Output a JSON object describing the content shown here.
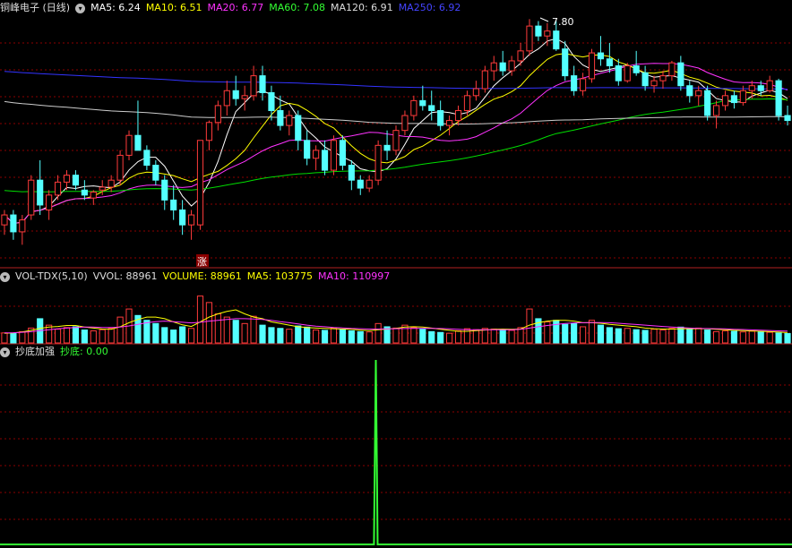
{
  "main_header": {
    "title": "铜峰电子 (日线)",
    "ma5": "MA5: 6.24",
    "ma10": "MA10: 6.51",
    "ma20": "MA20: 6.77",
    "ma60": "MA60: 7.08",
    "ma120": "MA120: 6.91",
    "ma250": "MA250: 6.92"
  },
  "vol_header": {
    "title": "VOL-TDX(5,10)",
    "vvol": "VVOL: 88961",
    "volume": "VOLUME: 88961",
    "ma5": "MA5: 103775",
    "ma10": "MA10: 110997"
  },
  "ind_header": {
    "title": "抄底加强",
    "value": "抄底: 0.00"
  },
  "annotations": {
    "high_label": "7.80",
    "zhang_label": "涨"
  },
  "colors": {
    "up": "#ff3b3b",
    "down": "#54ffff",
    "ma5": "#ffffff",
    "ma10": "#ffff00",
    "ma20": "#ff33ff",
    "ma60": "#00dd00",
    "ma120": "#cccccc",
    "ma250": "#3333ff",
    "signal": "#33ff33",
    "grid": "#8b0000"
  },
  "chart_data": [
    {
      "type": "candlestick",
      "ylim": [
        5.6,
        8.05
      ],
      "candles": [
        [
          5.95,
          6.1,
          5.85,
          6.05
        ],
        [
          6.05,
          6.1,
          5.8,
          5.88
        ],
        [
          5.88,
          6.05,
          5.75,
          6.0
        ],
        [
          6.05,
          6.45,
          6.0,
          6.4
        ],
        [
          6.4,
          6.6,
          6.05,
          6.15
        ],
        [
          6.1,
          6.3,
          6.0,
          6.25
        ],
        [
          6.25,
          6.45,
          6.2,
          6.38
        ],
        [
          6.38,
          6.5,
          6.3,
          6.45
        ],
        [
          6.45,
          6.5,
          6.3,
          6.35
        ],
        [
          6.3,
          6.4,
          6.2,
          6.25
        ],
        [
          6.22,
          6.3,
          6.15,
          6.28
        ],
        [
          6.3,
          6.4,
          6.25,
          6.33
        ],
        [
          6.33,
          6.45,
          6.28,
          6.4
        ],
        [
          6.4,
          6.7,
          6.35,
          6.65
        ],
        [
          6.65,
          6.9,
          6.6,
          6.85
        ],
        [
          6.85,
          7.2,
          6.75,
          6.7
        ],
        [
          6.7,
          6.75,
          6.5,
          6.55
        ],
        [
          6.55,
          6.6,
          6.35,
          6.4
        ],
        [
          6.4,
          6.45,
          6.1,
          6.2
        ],
        [
          6.2,
          6.35,
          6.0,
          6.1
        ],
        [
          6.1,
          6.2,
          5.85,
          5.95
        ],
        [
          5.95,
          6.1,
          5.8,
          6.05
        ],
        [
          5.95,
          6.3,
          5.9,
          6.8
        ],
        [
          6.8,
          7.0,
          6.7,
          6.98
        ],
        [
          6.98,
          7.2,
          6.9,
          7.15
        ],
        [
          7.15,
          7.4,
          7.05,
          7.3
        ],
        [
          7.3,
          7.45,
          7.15,
          7.22
        ],
        [
          7.22,
          7.35,
          7.1,
          7.25
        ],
        [
          7.25,
          7.55,
          7.2,
          7.45
        ],
        [
          7.45,
          7.55,
          7.2,
          7.28
        ],
        [
          7.28,
          7.35,
          7.0,
          7.1
        ],
        [
          7.1,
          7.25,
          6.9,
          6.95
        ],
        [
          6.95,
          7.1,
          6.85,
          7.05
        ],
        [
          7.05,
          7.1,
          6.7,
          6.8
        ],
        [
          6.8,
          6.9,
          6.55,
          6.62
        ],
        [
          6.62,
          6.75,
          6.5,
          6.7
        ],
        [
          6.7,
          6.8,
          6.45,
          6.5
        ],
        [
          6.5,
          6.85,
          6.45,
          6.8
        ],
        [
          6.8,
          6.85,
          6.5,
          6.55
        ],
        [
          6.55,
          6.6,
          6.3,
          6.4
        ],
        [
          6.4,
          6.45,
          6.25,
          6.32
        ],
        [
          6.32,
          6.45,
          6.28,
          6.4
        ],
        [
          6.4,
          6.8,
          6.35,
          6.75
        ],
        [
          6.75,
          6.9,
          6.6,
          6.7
        ],
        [
          6.7,
          6.95,
          6.65,
          6.9
        ],
        [
          6.9,
          7.1,
          6.85,
          7.05
        ],
        [
          7.05,
          7.25,
          7.0,
          7.2
        ],
        [
          7.2,
          7.35,
          7.1,
          7.15
        ],
        [
          7.15,
          7.3,
          7.0,
          7.1
        ],
        [
          7.1,
          7.2,
          6.9,
          6.95
        ],
        [
          6.95,
          7.05,
          6.85,
          7.0
        ],
        [
          7.0,
          7.15,
          6.95,
          7.1
        ],
        [
          7.1,
          7.3,
          7.05,
          7.25
        ],
        [
          7.25,
          7.4,
          7.2,
          7.32
        ],
        [
          7.32,
          7.55,
          7.28,
          7.5
        ],
        [
          7.5,
          7.65,
          7.4,
          7.58
        ],
        [
          7.58,
          7.7,
          7.45,
          7.5
        ],
        [
          7.5,
          7.65,
          7.45,
          7.6
        ],
        [
          7.6,
          7.78,
          7.55,
          7.7
        ],
        [
          7.7,
          8.02,
          7.65,
          7.95
        ],
        [
          7.95,
          8.0,
          7.8,
          7.85
        ],
        [
          7.85,
          7.98,
          7.75,
          7.9
        ],
        [
          7.9,
          8.0,
          7.7,
          7.72
        ],
        [
          7.72,
          7.8,
          7.4,
          7.45
        ],
        [
          7.45,
          7.55,
          7.25,
          7.3
        ],
        [
          7.3,
          7.48,
          7.25,
          7.42
        ],
        [
          7.42,
          7.72,
          7.38,
          7.68
        ],
        [
          7.68,
          7.85,
          7.55,
          7.62
        ],
        [
          7.62,
          7.78,
          7.48,
          7.55
        ],
        [
          7.55,
          7.62,
          7.35,
          7.4
        ],
        [
          7.4,
          7.58,
          7.38,
          7.55
        ],
        [
          7.55,
          7.7,
          7.45,
          7.48
        ],
        [
          7.48,
          7.55,
          7.3,
          7.35
        ],
        [
          7.35,
          7.45,
          7.28,
          7.4
        ],
        [
          7.4,
          7.5,
          7.32,
          7.45
        ],
        [
          7.45,
          7.6,
          7.4,
          7.58
        ],
        [
          7.58,
          7.65,
          7.3,
          7.35
        ],
        [
          7.35,
          7.4,
          7.18,
          7.25
        ],
        [
          7.25,
          7.35,
          7.15,
          7.3
        ],
        [
          7.3,
          7.35,
          7.0,
          7.05
        ],
        [
          7.05,
          7.2,
          6.92,
          7.15
        ],
        [
          7.15,
          7.3,
          7.1,
          7.25
        ],
        [
          7.25,
          7.3,
          7.12,
          7.18
        ],
        [
          7.18,
          7.35,
          7.15,
          7.3
        ],
        [
          7.3,
          7.4,
          7.22,
          7.35
        ],
        [
          7.35,
          7.4,
          7.25,
          7.3
        ],
        [
          7.3,
          7.45,
          7.28,
          7.4
        ],
        [
          7.4,
          7.42,
          7.0,
          7.05
        ],
        [
          7.05,
          7.15,
          6.95,
          7.0
        ]
      ]
    },
    {
      "type": "bar",
      "ylim": [
        0,
        360000
      ],
      "values": [
        62000,
        58000,
        70000,
        92000,
        150000,
        110000,
        85000,
        95000,
        100000,
        80000,
        75000,
        82000,
        90000,
        160000,
        210000,
        170000,
        140000,
        120000,
        95000,
        80000,
        100000,
        90000,
        290000,
        250000,
        180000,
        160000,
        140000,
        120000,
        165000,
        110000,
        95000,
        90000,
        85000,
        105000,
        98000,
        80000,
        78000,
        92000,
        85000,
        75000,
        70000,
        68000,
        120000,
        100000,
        92000,
        110000,
        95000,
        85000,
        70000,
        65000,
        60000,
        75000,
        88000,
        82000,
        90000,
        86000,
        80000,
        78000,
        95000,
        210000,
        150000,
        130000,
        140000,
        115000,
        120000,
        100000,
        140000,
        110000,
        95000,
        88000,
        90000,
        82000,
        78000,
        85000,
        80000,
        90000,
        98000,
        86000,
        92000,
        80000,
        70000,
        75000,
        72000,
        68000,
        73000,
        70000,
        66000,
        62000,
        58000
      ],
      "ma5": [
        60000,
        62000,
        68000,
        78000,
        90000,
        98000,
        102000,
        108000,
        108000,
        98000,
        92000,
        86000,
        85000,
        100000,
        125000,
        145000,
        160000,
        160000,
        150000,
        130000,
        112000,
        102000,
        130000,
        160000,
        180000,
        195000,
        205000,
        180000,
        160000,
        150000,
        130000,
        120000,
        110000,
        100000,
        95000,
        92000,
        90000,
        88000,
        86000,
        84000,
        80000,
        76000,
        82000,
        86000,
        90000,
        98000,
        100000,
        98000,
        92000,
        85000,
        78000,
        72000,
        72000,
        76000,
        80000,
        84000,
        86000,
        84000,
        86000,
        110000,
        125000,
        135000,
        140000,
        140000,
        135000,
        125000,
        125000,
        122000,
        115000,
        110000,
        105000,
        100000,
        92000,
        88000,
        86000,
        86000,
        88000,
        88000,
        88000,
        88000,
        85000,
        82000,
        78000,
        76000,
        74000,
        72000,
        70000,
        67000,
        64000
      ],
      "ma10": [
        62000,
        63000,
        66000,
        70000,
        76000,
        82000,
        88000,
        92000,
        96000,
        98000,
        98000,
        96000,
        95000,
        98000,
        105000,
        115000,
        125000,
        132000,
        135000,
        132000,
        128000,
        124000,
        128000,
        135000,
        140000,
        145000,
        150000,
        150000,
        148000,
        145000,
        140000,
        132000,
        125000,
        118000,
        110000,
        104000,
        100000,
        96000,
        93000,
        90000,
        88000,
        86000,
        86000,
        87000,
        88000,
        89000,
        90000,
        90000,
        90000,
        89000,
        87000,
        84000,
        82000,
        82000,
        82000,
        82000,
        82000,
        82000,
        84000,
        92000,
        100000,
        108000,
        114000,
        120000,
        124000,
        125000,
        126000,
        126000,
        125000,
        122000,
        118000,
        114000,
        110000,
        106000,
        102000,
        98000,
        95000,
        92000,
        90000,
        89000,
        88000,
        87000,
        85000,
        83000,
        81000,
        79000,
        77000,
        75000,
        73000
      ]
    },
    {
      "type": "line",
      "ylim": [
        0,
        1
      ],
      "values": [
        0,
        0,
        0,
        0,
        0,
        0,
        0,
        0,
        0,
        0,
        0,
        0,
        0,
        0,
        0,
        0,
        0,
        0,
        0,
        0,
        0,
        0,
        0,
        0,
        0,
        0,
        0,
        0,
        0,
        0,
        0,
        0,
        0,
        0,
        0,
        0,
        0,
        0,
        0,
        0,
        0,
        0,
        0,
        0,
        0,
        0,
        0,
        0,
        0,
        0,
        0,
        0,
        0,
        0,
        0,
        0,
        0,
        0,
        0,
        0,
        0,
        0,
        0,
        0,
        0,
        0,
        0,
        0,
        0,
        0,
        0,
        0,
        0,
        0,
        0,
        0,
        0,
        0,
        0,
        0,
        0,
        0,
        0,
        0,
        0,
        0,
        0,
        0,
        0,
        0,
        0,
        0,
        0,
        0,
        0,
        0,
        0,
        0,
        0,
        0,
        0,
        0,
        0,
        0,
        0,
        0,
        0,
        0,
        0,
        0,
        0,
        0,
        0,
        0,
        0,
        0,
        0,
        0,
        0,
        0,
        0,
        0,
        0,
        0,
        0,
        0,
        0,
        0,
        0,
        0,
        0,
        0,
        0,
        0,
        0,
        0,
        0,
        0,
        0,
        0,
        0,
        0,
        0,
        0,
        0,
        0,
        0,
        0,
        0,
        0,
        0,
        0,
        0,
        0,
        0,
        0,
        0,
        0,
        0,
        0,
        0,
        0,
        0,
        0,
        0,
        0,
        0,
        0,
        0,
        0,
        0,
        0,
        0,
        0,
        0,
        0,
        0,
        0,
        0,
        0,
        0,
        0,
        0,
        0,
        0,
        0,
        0,
        0,
        0,
        0,
        0,
        0,
        0,
        0,
        0,
        0,
        0,
        0,
        0,
        0,
        0,
        0,
        0,
        0,
        0,
        1,
        0,
        0,
        0,
        0,
        0,
        0,
        0,
        0,
        0,
        0,
        0,
        0,
        0,
        0,
        0,
        0,
        0,
        0,
        0,
        0,
        0,
        0,
        0,
        0,
        0,
        0,
        0,
        0,
        0,
        0,
        0,
        0,
        0,
        0,
        0,
        0,
        0,
        0,
        0,
        0,
        0,
        0,
        0,
        0,
        0,
        0,
        0,
        0,
        0,
        0,
        0,
        0,
        0,
        0,
        0,
        0,
        0,
        0,
        0,
        0,
        0,
        0,
        0,
        0,
        0,
        0,
        0,
        0,
        0,
        0,
        0,
        0,
        0,
        0,
        0,
        0,
        0,
        0,
        0,
        0,
        0,
        0,
        0,
        0,
        0,
        0,
        0,
        0,
        0,
        0,
        0,
        0,
        0,
        0,
        0,
        0,
        0,
        0,
        0,
        0,
        0,
        0,
        0,
        0,
        0,
        0,
        0,
        0,
        0,
        0,
        0,
        0,
        0,
        0,
        0,
        0,
        0,
        0,
        0,
        0,
        0,
        0,
        0,
        0,
        0,
        0,
        0,
        0,
        0,
        0,
        0,
        0,
        0,
        0,
        0,
        0,
        0,
        0,
        0,
        0,
        0,
        0,
        0,
        0,
        0,
        0,
        0,
        0,
        0,
        0,
        0,
        0,
        0,
        0,
        0,
        0,
        0,
        0,
        0,
        0,
        0,
        0,
        0,
        0,
        0,
        0,
        0,
        0,
        0,
        0,
        0,
        0,
        0,
        0,
        0,
        0,
        0,
        0,
        0,
        0,
        0,
        0,
        0,
        0,
        0,
        0,
        0,
        0,
        0,
        0,
        0,
        0,
        0,
        0,
        0,
        0,
        0,
        0,
        0,
        0,
        0,
        0,
        0,
        0,
        0,
        0,
        0,
        0,
        0,
        0,
        0,
        0,
        0,
        0,
        0,
        0,
        0,
        0,
        0,
        0,
        0,
        0,
        0,
        0,
        0,
        0,
        0
      ]
    }
  ]
}
